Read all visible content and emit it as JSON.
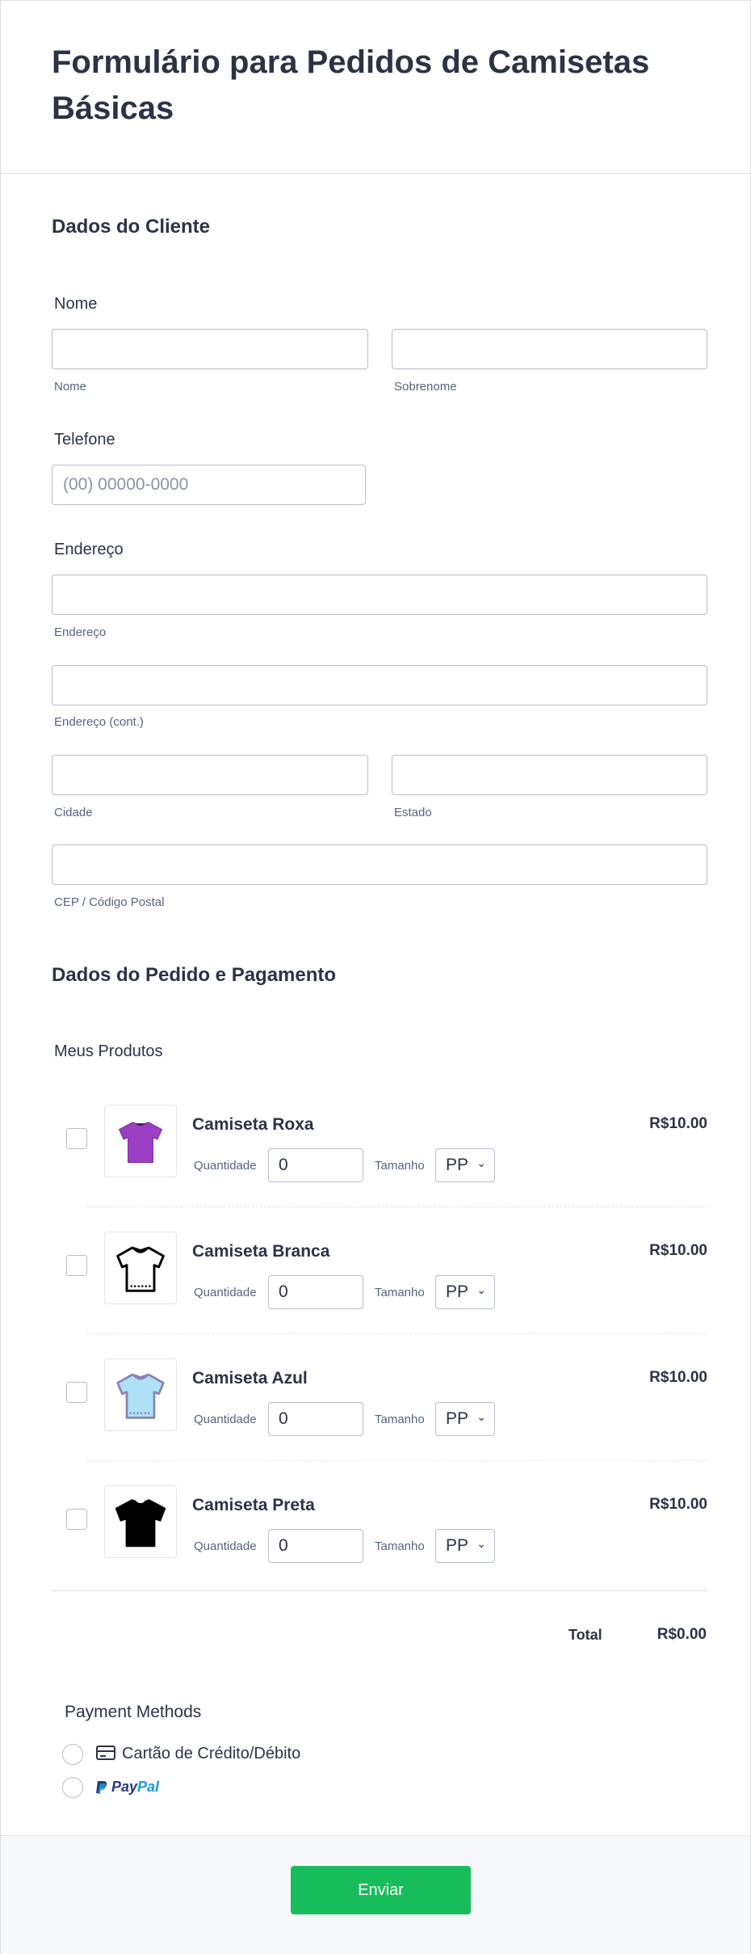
{
  "form": {
    "title": "Formulário para Pedidos de Camisetas Básicas"
  },
  "customer": {
    "section_title": "Dados do Cliente",
    "name_label": "Nome",
    "first_sublabel": "Nome",
    "last_sublabel": "Sobrenome",
    "phone_label": "Telefone",
    "phone_placeholder": "(00) 00000-0000",
    "address_label": "Endereço",
    "street_sublabel": "Endereço",
    "street2_sublabel": "Endereço (cont.)",
    "city_sublabel": "Cidade",
    "state_sublabel": "Estado",
    "zip_sublabel": "CEP / Código Postal"
  },
  "order": {
    "section_title": "Dados do Pedido e Pagamento",
    "products_label": "Meus Produtos",
    "quantity_label": "Quantidade",
    "size_label": "Tamanho",
    "products": [
      {
        "name": "Camiseta Roxa",
        "price": "R$10.00",
        "quantity": "0",
        "size": "PP",
        "image": "purple-tshirt-icon",
        "color": "#9b3fc4"
      },
      {
        "name": "Camiseta Branca",
        "price": "R$10.00",
        "quantity": "0",
        "size": "PP",
        "image": "white-tshirt-icon",
        "color": "#ffffff"
      },
      {
        "name": "Camiseta Azul",
        "price": "R$10.00",
        "quantity": "0",
        "size": "PP",
        "image": "blue-tshirt-icon",
        "color": "#aee0f7"
      },
      {
        "name": "Camiseta Preta",
        "price": "R$10.00",
        "quantity": "0",
        "size": "PP",
        "image": "black-tshirt-icon",
        "color": "#000000"
      }
    ],
    "total_label": "Total",
    "total_value": "R$0.00"
  },
  "payment": {
    "label": "Payment Methods",
    "card_label": "Cartão de Crédito/Débito",
    "paypal_part1": "Pay",
    "paypal_part2": "Pal"
  },
  "footer": {
    "submit_label": "Enviar",
    "submit_color": "#18bd5b"
  }
}
